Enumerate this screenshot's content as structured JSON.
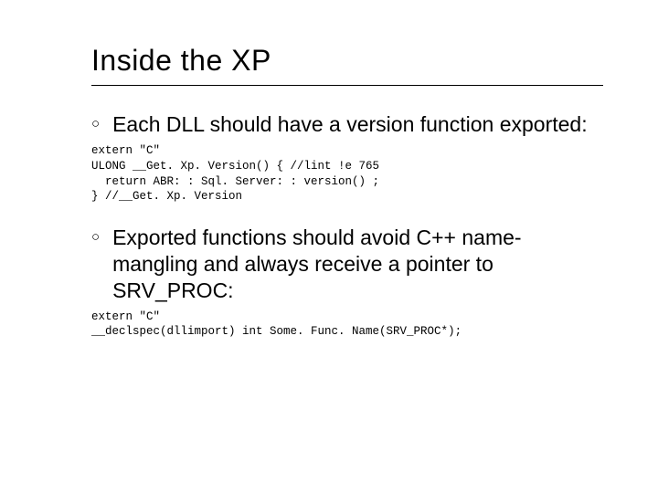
{
  "title": "Inside the XP",
  "items": [
    {
      "bullet": "Each DLL should have a version function exported:",
      "code": "extern \"C\"\nULONG __Get. Xp. Version() { //lint !e 765\n  return ABR: : Sql. Server: : version() ;\n} //__Get. Xp. Version"
    },
    {
      "bullet": "Exported functions should avoid C++ name-mangling and always receive a pointer to SRV_PROC:",
      "code": "extern \"C\"\n__declspec(dllimport) int Some. Func. Name(SRV_PROC*);"
    }
  ]
}
